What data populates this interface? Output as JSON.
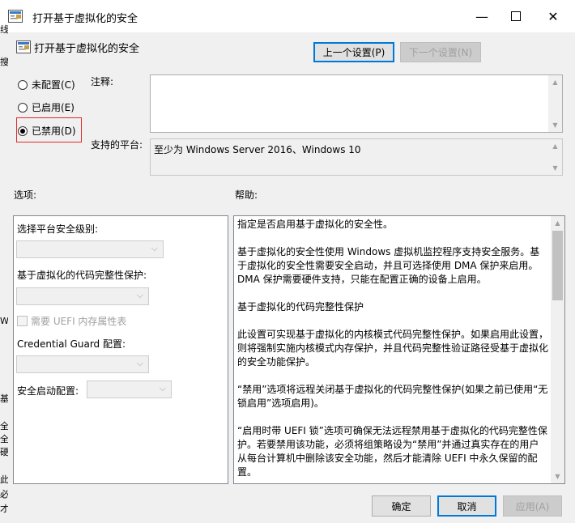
{
  "window": {
    "title": "打开基于虚拟化的安全"
  },
  "header": {
    "title": "打开基于虚拟化的安全",
    "prev_button": "上一个设置(P)",
    "next_button": "下一个设置(N)"
  },
  "state": {
    "options": [
      {
        "label": "未配置(C)",
        "selected": false
      },
      {
        "label": "已启用(E)",
        "selected": false
      },
      {
        "label": "已禁用(D)",
        "selected": true
      }
    ]
  },
  "comment": {
    "label": "注释:",
    "value": ""
  },
  "platform": {
    "label": "支持的平台:",
    "value": "至少为 Windows Server 2016、Windows 10"
  },
  "options_section": {
    "heading": "选项:",
    "platform_level_label": "选择平台安全级别:",
    "code_integrity_label": "基于虚拟化的代码完整性保护:",
    "uefi_checkbox_label": "需要 UEFI 内存属性表",
    "credential_guard_label": "Credential Guard 配置:",
    "secure_launch_label": "安全启动配置:"
  },
  "help_section": {
    "heading": "帮助:",
    "paragraphs": [
      "指定是否启用基于虚拟化的安全性。",
      "基于虚拟化的安全性使用 Windows 虚拟机监控程序支持安全服务。基于虚拟化的安全性需要安全启动，并且可选择使用 DMA 保护来启用。DMA 保护需要硬件支持，只能在配置正确的设备上启用。",
      "基于虚拟化的代码完整性保护",
      "此设置可实现基于虚拟化的内核模式代码完整性保护。如果启用此设置，则将强制实施内核模式内存保护，并且代码完整性验证路径受基于虚拟化的安全功能保护。",
      "“禁用”选项将远程关闭基于虚拟化的代码完整性保护(如果之前已使用“无锁启用”选项启用)。",
      "“启用时带 UEFI 锁”选项可确保无法远程禁用基于虚拟化的代码完整性保护。若要禁用该功能，必须将组策略设为“禁用”并通过真实存在的用户从每台计算机中删除该安全功能，然后才能清除 UEFI 中永久保留的配置。"
    ]
  },
  "buttons": {
    "ok": "确定",
    "cancel": "取消",
    "apply": "应用(A)"
  },
  "edge_text": [
    "线",
    "搜",
    "W",
    "基",
    "全",
    "全",
    "硬",
    "此",
    "必",
    "才"
  ],
  "icons": {
    "window_icon": "policy-settings-icon",
    "header_icon": "policy-settings-icon",
    "minimize": "minimize-icon",
    "maximize": "maximize-icon",
    "close": "close-icon"
  },
  "colors": {
    "default_button_border": "#0078d7",
    "highlight_border": "#e02a2a"
  }
}
